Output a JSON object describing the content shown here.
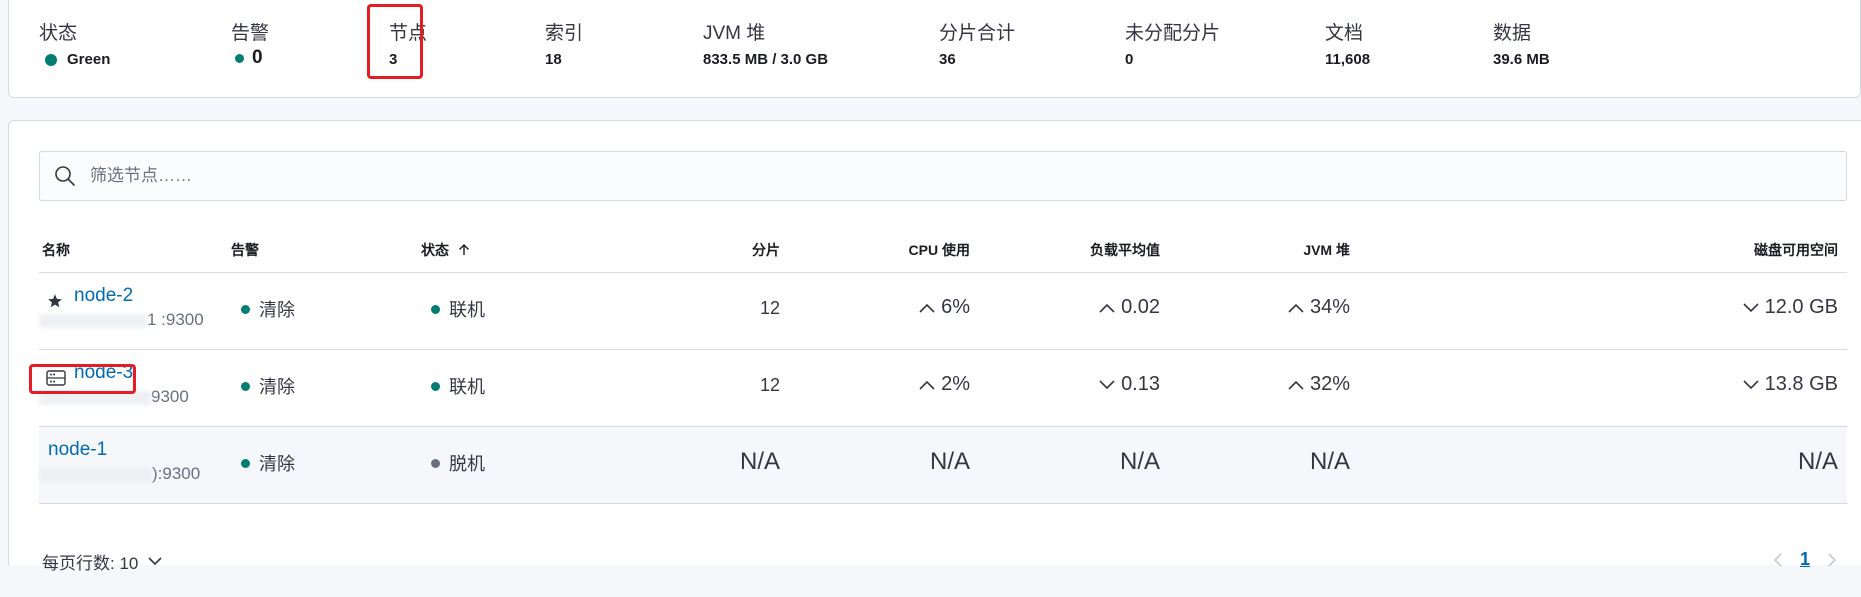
{
  "summary": {
    "status": {
      "label": "状态",
      "value": "Green"
    },
    "alerts": {
      "label": "告警",
      "value": "0"
    },
    "nodes": {
      "label": "节点",
      "value": "3"
    },
    "indices": {
      "label": "索引",
      "value": "18"
    },
    "jvm_heap": {
      "label": "JVM 堆",
      "value": "833.5 MB / 3.0 GB"
    },
    "total_shards": {
      "label": "分片合计",
      "value": "36"
    },
    "unassigned_shards": {
      "label": "未分配分片",
      "value": "0"
    },
    "documents": {
      "label": "文档",
      "value": "11,608"
    },
    "data": {
      "label": "数据",
      "value": "39.6 MB"
    }
  },
  "search": {
    "placeholder": "筛选节点……"
  },
  "table": {
    "headers": {
      "name": "名称",
      "alerts": "告警",
      "status": "状态",
      "status_sort_icon": "arrow-up-icon",
      "shards": "分片",
      "cpu": "CPU 使用",
      "load": "负载平均值",
      "jvm": "JVM 堆",
      "disk": "磁盘可用空间"
    },
    "rows": [
      {
        "type_icon": "star-icon",
        "name": "node-2",
        "address_visible": "1 :9300",
        "alert": "清除",
        "status": "联机",
        "status_color": "#017d73",
        "shards": "12",
        "cpu": {
          "trend": "up",
          "value": "6%"
        },
        "load": {
          "trend": "up",
          "value": "0.02"
        },
        "jvm": {
          "trend": "up",
          "value": "34%"
        },
        "disk": {
          "trend": "down",
          "value": "12.0 GB"
        }
      },
      {
        "type_icon": "server-icon",
        "name": "node-3",
        "address_visible": "9300",
        "alert": "清除",
        "status": "联机",
        "status_color": "#017d73",
        "shards": "12",
        "cpu": {
          "trend": "up",
          "value": "2%"
        },
        "load": {
          "trend": "down",
          "value": "0.13"
        },
        "jvm": {
          "trend": "up",
          "value": "32%"
        },
        "disk": {
          "trend": "down",
          "value": "13.8 GB"
        }
      },
      {
        "type_icon": "",
        "name": "node-1",
        "address_visible": "):9300",
        "alert": "清除",
        "status": "脱机",
        "status_color": "#69707d",
        "shards": "N/A",
        "cpu": {
          "trend": "",
          "value": "N/A"
        },
        "load": {
          "trend": "",
          "value": "N/A"
        },
        "jvm": {
          "trend": "",
          "value": "N/A"
        },
        "disk": {
          "trend": "",
          "value": "N/A"
        }
      }
    ]
  },
  "pagination": {
    "rows_per_page": "每页行数: 10",
    "current_page": "1"
  },
  "colors": {
    "link": "#006bb4",
    "status_green": "#017d73",
    "status_grey": "#69707d",
    "highlight": "#e51c23"
  }
}
